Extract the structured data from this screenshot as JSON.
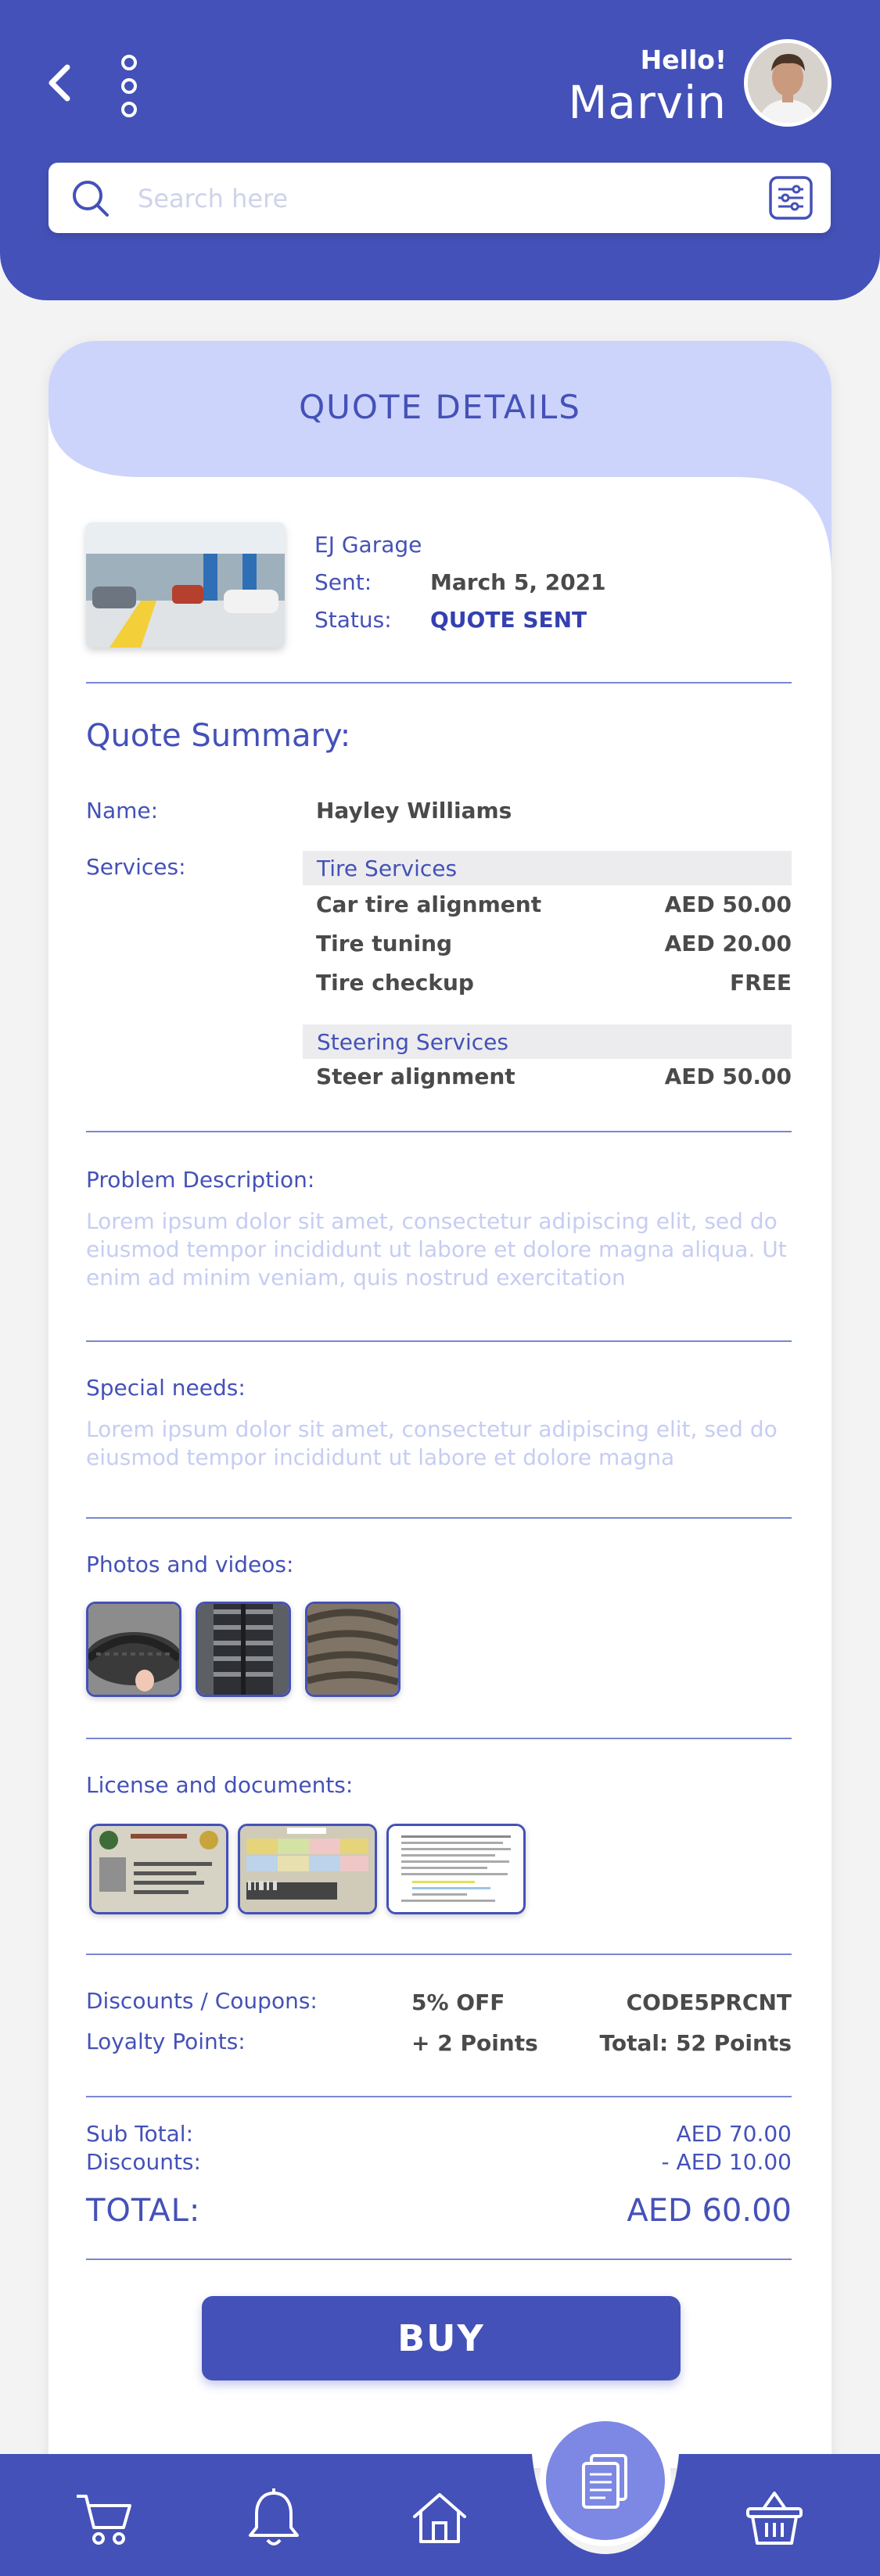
{
  "header": {
    "greeting": "Hello!",
    "user_name": "Marvin",
    "search_placeholder": "Search here",
    "icons": [
      "back-arrow-icon",
      "more-vertical-icon",
      "search-icon",
      "filter-sliders-icon"
    ]
  },
  "quote": {
    "title": "QUOTE DETAILS",
    "garage_name": "EJ Garage",
    "sent_label": "Sent:",
    "sent_value": "March 5, 2021",
    "status_label": "Status:",
    "status_value": "QUOTE SENT",
    "summary_title": "Quote Summary:",
    "name_label": "Name:",
    "name_value": "Hayley Williams",
    "services_label": "Services:",
    "service_groups": [
      {
        "name": "Tire Services",
        "items": [
          {
            "label": "Car tire alignment",
            "price": "AED 50.00"
          },
          {
            "label": "Tire tuning",
            "price": "AED 20.00"
          },
          {
            "label": "Tire checkup",
            "price": "FREE"
          }
        ]
      },
      {
        "name": "Steering Services",
        "items": [
          {
            "label": "Steer alignment",
            "price": "AED 50.00"
          }
        ]
      }
    ],
    "problem_label": "Problem Description:",
    "problem_text": "Lorem ipsum dolor sit amet, consectetur adipiscing elit, sed do eiusmod tempor incididunt ut labore et dolore magna aliqua. Ut enim ad minim veniam, quis nostrud exercitation",
    "special_label": "Special needs:",
    "special_text": "Lorem ipsum dolor sit amet, consectetur adipiscing elit, sed do eiusmod tempor incididunt ut labore et dolore magna",
    "photos_label": "Photos and videos:",
    "docs_label": "License and documents:",
    "discounts_label": "Discounts / Coupons:",
    "discount_value": "5% OFF",
    "coupon_code": "CODE5PRCNT",
    "loyalty_label": "Loyalty Points:",
    "loyalty_value": "+ 2 Points",
    "loyalty_total": "Total:  52 Points",
    "subtotal_label": "Sub Total:",
    "subtotal_value": "AED 70.00",
    "discounts_row_label": "Discounts:",
    "discounts_row_value": "- AED 10.00",
    "total_label": "TOTAL:",
    "total_value": "AED 60.00",
    "buy_label": "BUY"
  },
  "bottom_nav": {
    "items": [
      "cart-icon",
      "bell-icon",
      "home-icon",
      "quote-document-icon",
      "basket-icon"
    ]
  },
  "colors": {
    "primary": "#4451b8",
    "light_accent": "#cdd4fb",
    "fab": "#7d88e4",
    "lorem_text": "#c6cdf2"
  }
}
